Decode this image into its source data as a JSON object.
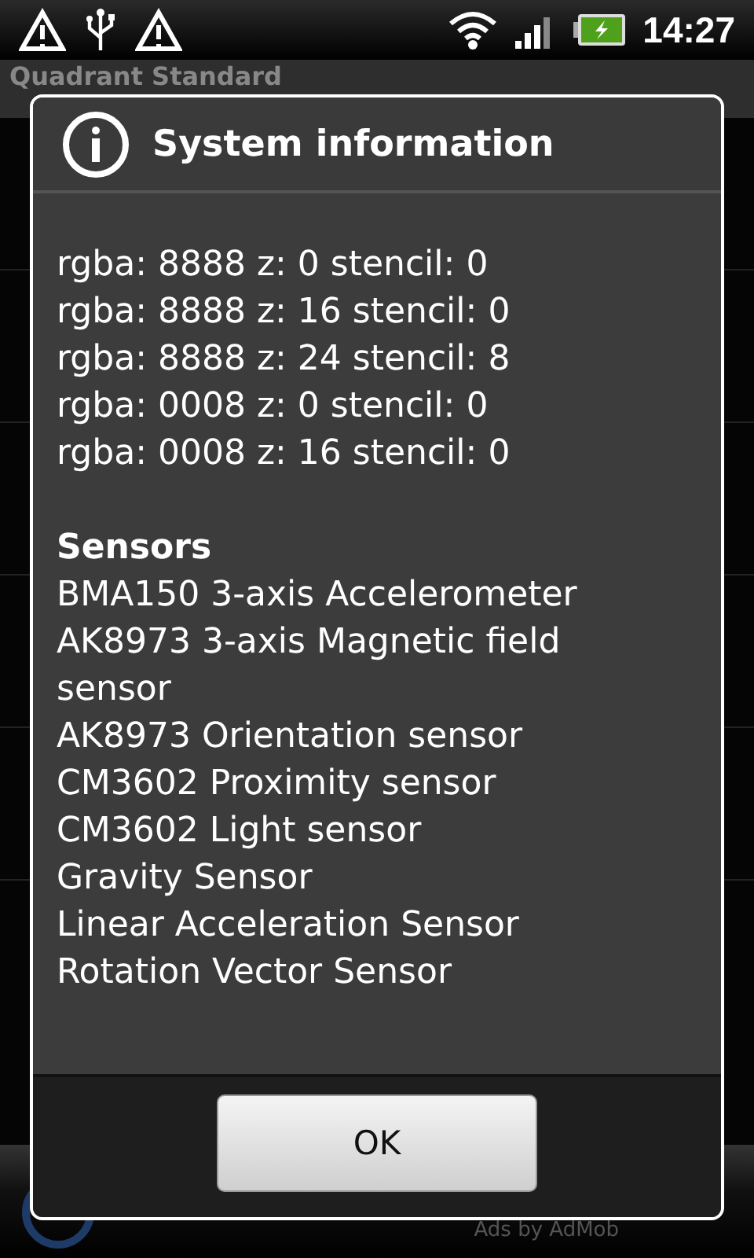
{
  "status_bar": {
    "time": "14:27"
  },
  "app": {
    "title": "Quadrant Standard",
    "ad_text": "Ads by AdMob"
  },
  "dialog": {
    "title": "System information",
    "config_lines": [
      "rgba: 8888 z: 0 stencil: 0",
      "rgba: 8888 z: 16 stencil: 0",
      "rgba: 8888 z: 24 stencil: 8",
      "rgba: 0008 z: 0 stencil: 0",
      "rgba: 0008 z: 16 stencil: 0"
    ],
    "sensors": {
      "heading": "Sensors",
      "items": [
        "BMA150 3-axis Accelerometer",
        "AK8973 3-axis Magnetic field sensor",
        "AK8973 Orientation sensor",
        "CM3602 Proximity sensor",
        "CM3602 Light sensor",
        "Gravity Sensor",
        "Linear Acceleration Sensor",
        "Rotation Vector Sensor"
      ]
    },
    "buttons": [
      {
        "label": "OK"
      }
    ]
  }
}
